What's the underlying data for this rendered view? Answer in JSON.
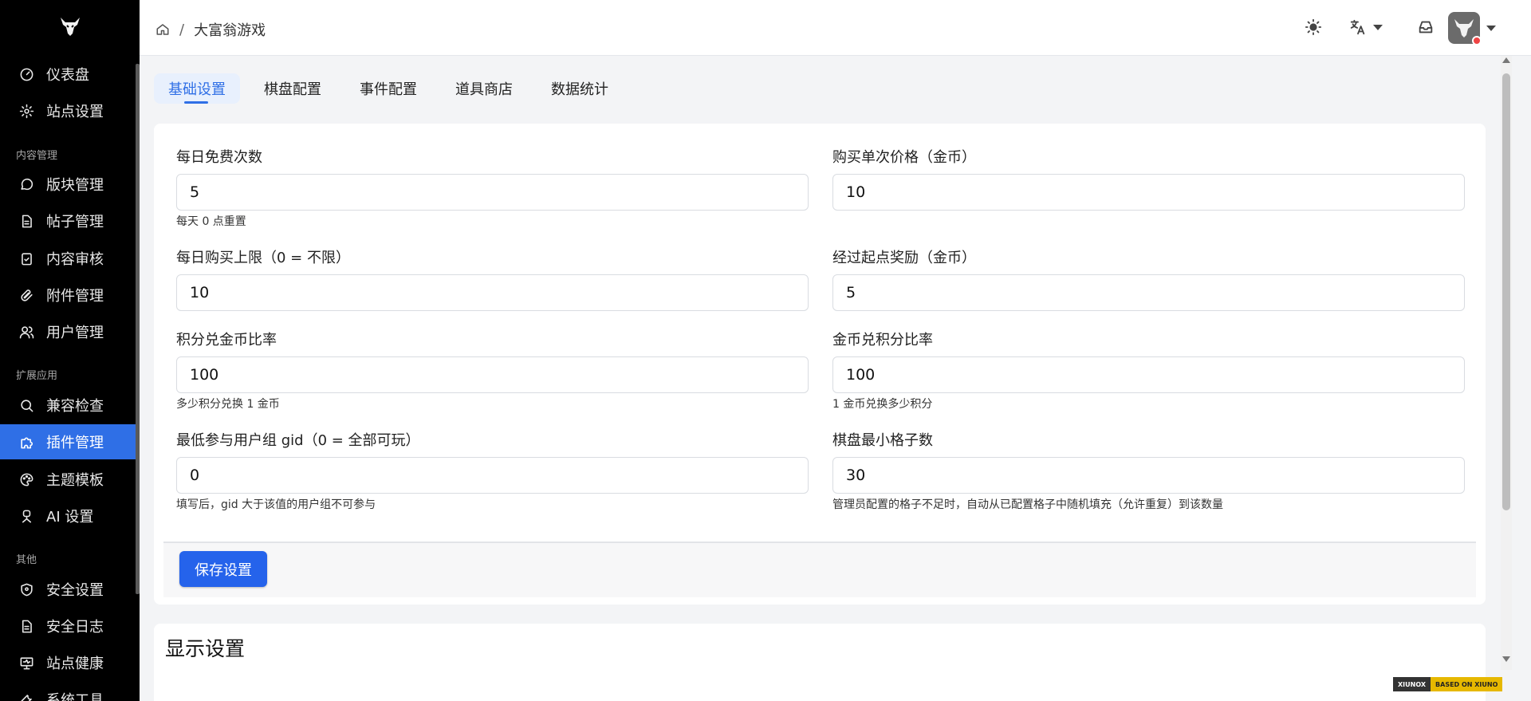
{
  "sidebar": {
    "items": [
      {
        "label": "仪表盘",
        "icon": "dashboard-icon"
      },
      {
        "label": "站点设置",
        "icon": "gear-icon"
      },
      {
        "label": "版块管理",
        "icon": "chat-bubble-icon"
      },
      {
        "label": "帖子管理",
        "icon": "document-icon"
      },
      {
        "label": "内容审核",
        "icon": "clipboard-check-icon"
      },
      {
        "label": "附件管理",
        "icon": "paperclip-icon"
      },
      {
        "label": "用户管理",
        "icon": "users-icon"
      },
      {
        "label": "兼容检查",
        "icon": "search-icon"
      },
      {
        "label": "插件管理",
        "icon": "puzzle-icon"
      },
      {
        "label": "主题模板",
        "icon": "palette-icon"
      },
      {
        "label": "AI 设置",
        "icon": "robot-icon"
      },
      {
        "label": "安全设置",
        "icon": "shield-icon"
      },
      {
        "label": "安全日志",
        "icon": "log-icon"
      },
      {
        "label": "站点健康",
        "icon": "monitor-icon"
      },
      {
        "label": "系统工具",
        "icon": "tool-icon"
      }
    ],
    "sections": {
      "content": "内容管理",
      "extensions": "扩展应用",
      "other": "其他"
    },
    "active_item": "插件管理"
  },
  "header": {
    "breadcrumb": "大富翁游戏",
    "breadcrumb_separator": "/"
  },
  "tabs": [
    "基础设置",
    "棋盘配置",
    "事件配置",
    "道具商店",
    "数据统计"
  ],
  "active_tab": "基础设置",
  "form": {
    "daily_free": {
      "label": "每日免费次数",
      "value": "5",
      "help": "每天 0 点重置"
    },
    "buy_price": {
      "label": "购买单次价格（金币）",
      "value": "10"
    },
    "daily_buy_limit": {
      "label": "每日购买上限（0 = 不限）",
      "value": "10"
    },
    "pass_start_reward": {
      "label": "经过起点奖励（金币）",
      "value": "5"
    },
    "points_to_coin": {
      "label": "积分兑金币比率",
      "value": "100",
      "help": "多少积分兑换 1 金币"
    },
    "coin_to_points": {
      "label": "金币兑积分比率",
      "value": "100",
      "help": "1 金币兑换多少积分"
    },
    "min_group_gid": {
      "label": "最低参与用户组 gid（0 = 全部可玩）",
      "value": "0",
      "help": "填写后，gid 大于该值的用户组不可参与"
    },
    "min_board_cells": {
      "label": "棋盘最小格子数",
      "value": "30",
      "help": "管理员配置的格子不足时，自动从已配置格子中随机填充（允许重复）到该数量"
    }
  },
  "save_label": "保存设置",
  "display_section_title": "显示设置",
  "badge": {
    "left": "XIUNOX",
    "right": "BASED ON XIUNO"
  },
  "colors": {
    "accent": "#2f6fe6",
    "sidebar_bg": "#000000",
    "save_button": "#2563eb"
  }
}
